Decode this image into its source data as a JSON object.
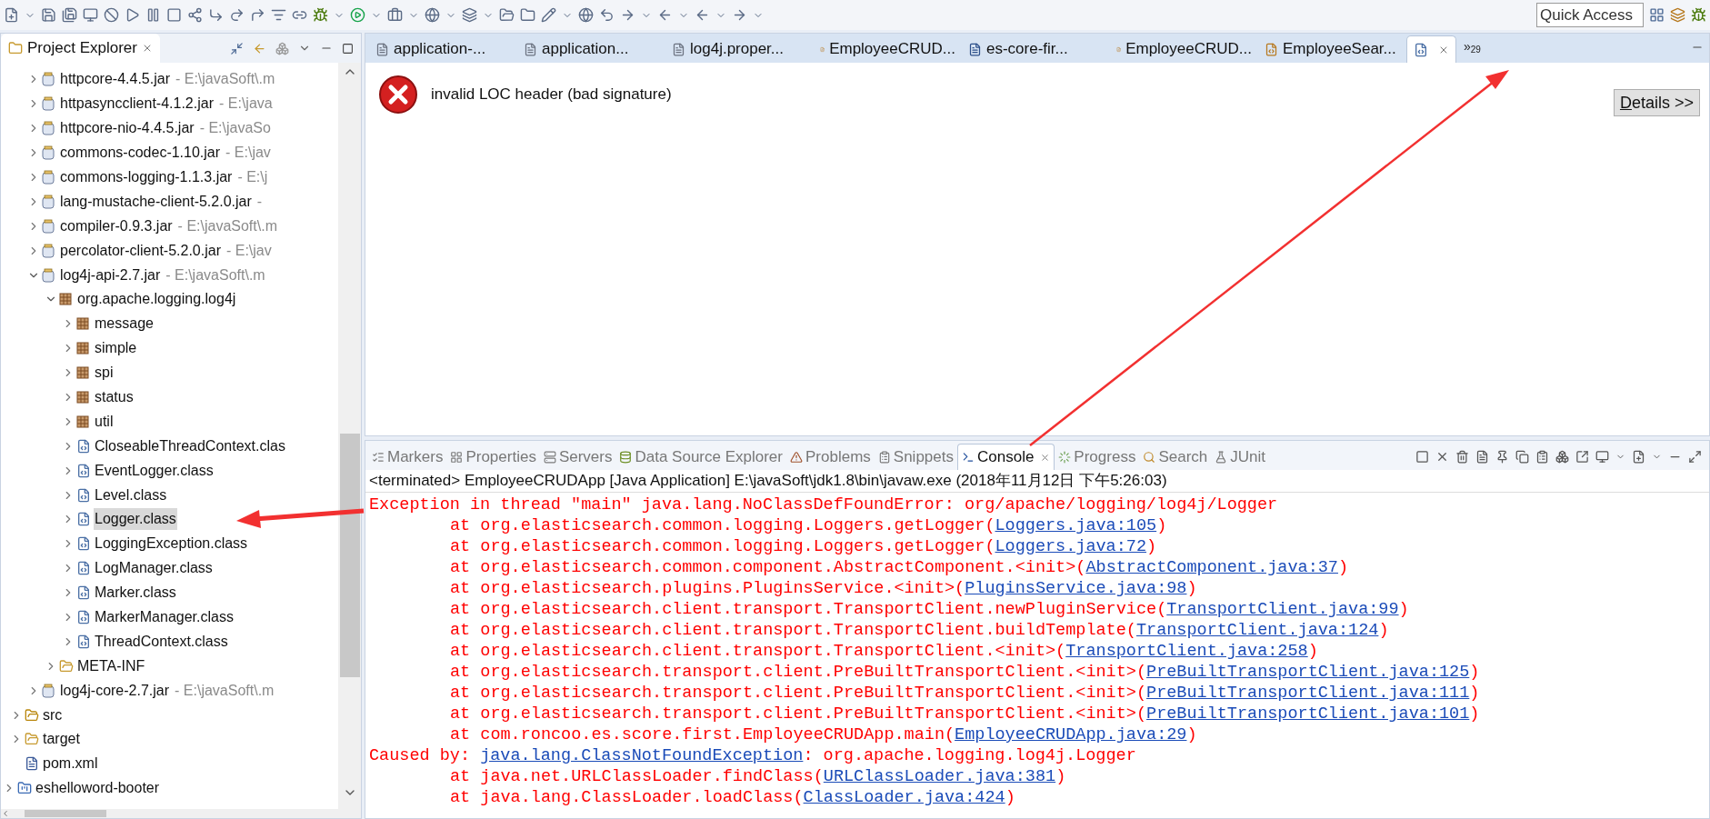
{
  "toolbar": {
    "quick_access": {
      "placeholder": "Quick Access"
    }
  },
  "project_explorer": {
    "title": "Project Explorer",
    "tree": [
      {
        "children": [
          {
            "children": [
              {
                "kind": "jar",
                "label": "httpcore-4.4.5.jar",
                "decoration": "- E:\\javaSoft\\.m",
                "expanded": false,
                "selected": false
              },
              {
                "kind": "jar",
                "label": "httpasyncclient-4.1.2.jar",
                "decoration": "- E:\\java",
                "expanded": false,
                "selected": false
              },
              {
                "kind": "jar",
                "label": "httpcore-nio-4.4.5.jar",
                "decoration": "- E:\\javaSo",
                "expanded": false,
                "selected": false
              },
              {
                "kind": "jar",
                "label": "commons-codec-1.10.jar",
                "decoration": "- E:\\jav",
                "expanded": false,
                "selected": false
              },
              {
                "kind": "jar",
                "label": "commons-logging-1.1.3.jar",
                "decoration": "- E:\\j",
                "expanded": false,
                "selected": false
              },
              {
                "kind": "jar",
                "label": "lang-mustache-client-5.2.0.jar",
                "decoration": "-",
                "expanded": false,
                "selected": false
              },
              {
                "kind": "jar",
                "label": "compiler-0.9.3.jar",
                "decoration": "- E:\\javaSoft\\.m",
                "expanded": false,
                "selected": false
              },
              {
                "kind": "jar",
                "label": "percolator-client-5.2.0.jar",
                "decoration": "- E:\\jav",
                "expanded": false,
                "selected": false
              },
              {
                "kind": "jar",
                "label": "log4j-api-2.7.jar",
                "decoration": "- E:\\javaSoft\\.m",
                "expanded": true,
                "selected": false,
                "children": [
                  {
                    "kind": "package",
                    "label": "org.apache.logging.log4j",
                    "expanded": true,
                    "selected": false,
                    "children": [
                      {
                        "kind": "package",
                        "label": "message",
                        "expanded": false,
                        "selected": false
                      },
                      {
                        "kind": "package",
                        "label": "simple",
                        "expanded": false,
                        "selected": false
                      },
                      {
                        "kind": "package",
                        "label": "spi",
                        "expanded": false,
                        "selected": false
                      },
                      {
                        "kind": "package",
                        "label": "status",
                        "expanded": false,
                        "selected": false
                      },
                      {
                        "kind": "package",
                        "label": "util",
                        "expanded": false,
                        "selected": false
                      },
                      {
                        "kind": "class",
                        "label": "CloseableThreadContext.clas",
                        "expanded": false,
                        "selected": false
                      },
                      {
                        "kind": "class",
                        "label": "EventLogger.class",
                        "expanded": false,
                        "selected": false
                      },
                      {
                        "kind": "class",
                        "label": "Level.class",
                        "expanded": false,
                        "selected": false
                      },
                      {
                        "kind": "class",
                        "label": "Logger.class",
                        "expanded": false,
                        "selected": true
                      },
                      {
                        "kind": "class",
                        "label": "LoggingException.class",
                        "expanded": false,
                        "selected": false
                      },
                      {
                        "kind": "class",
                        "label": "LogManager.class",
                        "expanded": false,
                        "selected": false
                      },
                      {
                        "kind": "class",
                        "label": "Marker.class",
                        "expanded": false,
                        "selected": false
                      },
                      {
                        "kind": "class",
                        "label": "MarkerManager.class",
                        "expanded": false,
                        "selected": false
                      },
                      {
                        "kind": "class",
                        "label": "ThreadContext.class",
                        "expanded": false,
                        "selected": false
                      }
                    ]
                  },
                  {
                    "kind": "folder",
                    "label": "META-INF",
                    "expanded": false,
                    "selected": false
                  }
                ]
              },
              {
                "kind": "jar",
                "label": "log4j-core-2.7.jar",
                "decoration": "- E:\\javaSoft\\.m",
                "expanded": false,
                "selected": false
              }
            ]
          },
          {
            "kind": "source",
            "label": "src",
            "expanded": false,
            "selected": false
          },
          {
            "kind": "folder",
            "label": "target",
            "expanded": false,
            "selected": false
          },
          {
            "kind": "file",
            "label": "pom.xml",
            "selected": false
          }
        ]
      },
      {
        "kind": "project",
        "label": "eshelloword-booter",
        "expanded": false,
        "selected": false
      }
    ]
  },
  "editor": {
    "tabs": [
      {
        "kind": "text",
        "label": "application-...",
        "selected": false
      },
      {
        "kind": "text",
        "label": "application...",
        "selected": false
      },
      {
        "kind": "text",
        "label": "log4j.proper...",
        "selected": false
      },
      {
        "kind": "java",
        "label": "EmployeeCRUD...",
        "selected": false
      },
      {
        "kind": "maven",
        "label": "es-core-fir...",
        "selected": false
      },
      {
        "kind": "java",
        "label": "EmployeeCRUD...",
        "selected": false
      },
      {
        "kind": "java",
        "label": "EmployeeSear...",
        "selected": false
      },
      {
        "kind": "class",
        "selected": true
      }
    ],
    "overflow": {
      "glyph": "»",
      "count": "29"
    },
    "error": "invalid LOC header (bad signature)",
    "details_button": "Details >>"
  },
  "console_panel": {
    "tabs": [
      {
        "kind": "markers",
        "label": "Markers",
        "selected": false
      },
      {
        "kind": "properties",
        "label": "Properties",
        "selected": false
      },
      {
        "kind": "servers",
        "label": "Servers",
        "selected": false
      },
      {
        "kind": "datasource",
        "label": "Data Source Explorer",
        "selected": false
      },
      {
        "kind": "problems",
        "label": "Problems",
        "selected": false
      },
      {
        "kind": "snippets",
        "label": "Snippets",
        "selected": false
      },
      {
        "kind": "console",
        "label": "Console",
        "selected": true
      },
      {
        "kind": "progress",
        "label": "Progress",
        "selected": false
      },
      {
        "kind": "search",
        "label": "Search",
        "selected": false
      },
      {
        "kind": "junit",
        "label": "JUnit",
        "selected": false
      }
    ],
    "header": "<terminated> EmployeeCRUDApp [Java Application] E:\\javaSoft\\jdk1.8\\bin\\javaw.exe (2018年11月12日 下午5:26:03)",
    "lines": [
      {
        "kind": "error",
        "text": "Exception in thread \"main\" java.lang.NoClassDefFoundError: org/apache/logging/log4j/Logger"
      },
      {
        "kind": "trace",
        "text": "at org.elasticsearch.common.logging.Loggers.getLogger(",
        "link": "Loggers.java:105",
        "after": ")"
      },
      {
        "kind": "trace",
        "text": "at org.elasticsearch.common.logging.Loggers.getLogger(",
        "link": "Loggers.java:72",
        "after": ")"
      },
      {
        "kind": "trace",
        "text": "at org.elasticsearch.common.component.AbstractComponent.<init>(",
        "link": "AbstractComponent.java:37",
        "after": ")"
      },
      {
        "kind": "trace",
        "text": "at org.elasticsearch.plugins.PluginsService.<init>(",
        "link": "PluginsService.java:98",
        "after": ")"
      },
      {
        "kind": "trace",
        "text": "at org.elasticsearch.client.transport.TransportClient.newPluginService(",
        "link": "TransportClient.java:99",
        "after": ")"
      },
      {
        "kind": "trace",
        "text": "at org.elasticsearch.client.transport.TransportClient.buildTemplate(",
        "link": "TransportClient.java:124",
        "after": ")"
      },
      {
        "kind": "trace",
        "text": "at org.elasticsearch.client.transport.TransportClient.<init>(",
        "link": "TransportClient.java:258",
        "after": ")"
      },
      {
        "kind": "trace",
        "text": "at org.elasticsearch.transport.client.PreBuiltTransportClient.<init>(",
        "link": "PreBuiltTransportClient.java:125",
        "after": ")"
      },
      {
        "kind": "trace",
        "text": "at org.elasticsearch.transport.client.PreBuiltTransportClient.<init>(",
        "link": "PreBuiltTransportClient.java:111",
        "after": ")"
      },
      {
        "kind": "trace",
        "text": "at org.elasticsearch.transport.client.PreBuiltTransportClient.<init>(",
        "link": "PreBuiltTransportClient.java:101",
        "after": ")"
      },
      {
        "kind": "trace",
        "text": "at com.roncoo.es.score.first.EmployeeCRUDApp.main(",
        "link": "EmployeeCRUDApp.java:29",
        "after": ")"
      },
      {
        "kind": "error",
        "text": "Caused by: ",
        "link": "java.lang.ClassNotFoundException",
        "after": ": org.apache.logging.log4j.Logger"
      },
      {
        "kind": "trace",
        "text": "at java.net.URLClassLoader.findClass(",
        "link": "URLClassLoader.java:381",
        "after": ")"
      },
      {
        "kind": "trace",
        "text": "at java.lang.ClassLoader.loadClass(",
        "link": "ClassLoader.java:424",
        "after": ")"
      }
    ]
  }
}
